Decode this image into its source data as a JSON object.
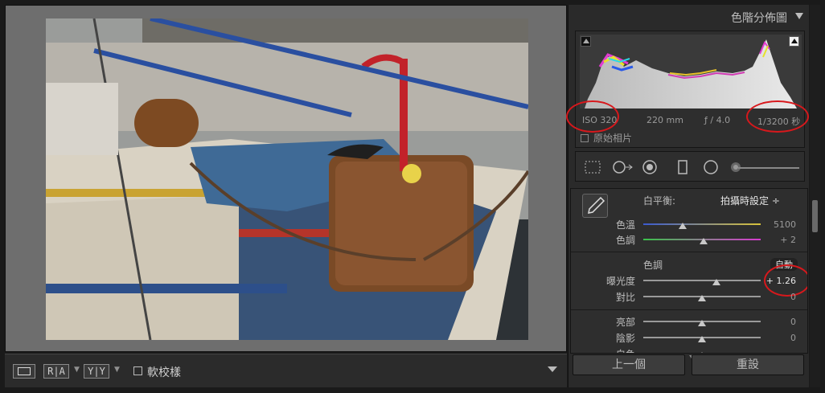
{
  "histogram": {
    "title": "色階分佈圖",
    "iso": "ISO 320",
    "focal_length": "220 mm",
    "aperture": "ƒ / 4.0",
    "shutter": "1/3200 秒",
    "original_photo_label": "原始相片"
  },
  "toolbar": {
    "view_btn_1": "▭",
    "view_btn_2": "R|A",
    "view_btn_3": "Y|Y",
    "softproof_label": "軟校樣"
  },
  "basic": {
    "white_balance_label": "白平衡:",
    "white_balance_value": "拍攝時設定 ÷",
    "temp_label": "色溫",
    "temp_value": "5100",
    "tint_label": "色調",
    "tint_value": "+ 2",
    "tone_title": "色調",
    "tone_auto": "自動",
    "exposure_label": "曝光度",
    "exposure_value": "+ 1.26",
    "contrast_label": "對比",
    "contrast_value": "0",
    "highlights_label": "亮部",
    "highlights_value": "0",
    "shadows_label": "陰影",
    "shadows_value": "0",
    "whites_label": "白色"
  },
  "buttons": {
    "previous": "上一個",
    "reset": "重設"
  },
  "colors": {
    "annotation_ring": "#d8181c",
    "panel_bg": "#2a2a2a",
    "workspace_bg": "#6e6e6e"
  }
}
